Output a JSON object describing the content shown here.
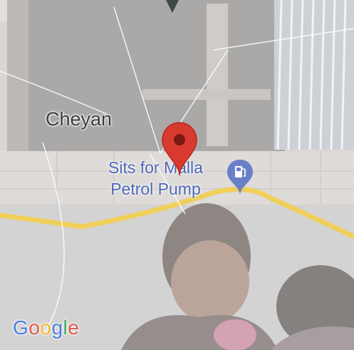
{
  "map": {
    "place_label": "Cheyan",
    "poi": {
      "line1": "Sits for Malla",
      "line2": "Petrol Pump",
      "icon": "fuel-station-icon"
    },
    "pin_icon": "location-pin-icon",
    "attribution": {
      "g1": "G",
      "o1": "o",
      "o2": "o",
      "g2": "g",
      "l": "l",
      "e": "e"
    },
    "colors": {
      "pin": "#d93a2f",
      "poi_text": "#4d67b8",
      "road": "#f0cf5a"
    }
  }
}
